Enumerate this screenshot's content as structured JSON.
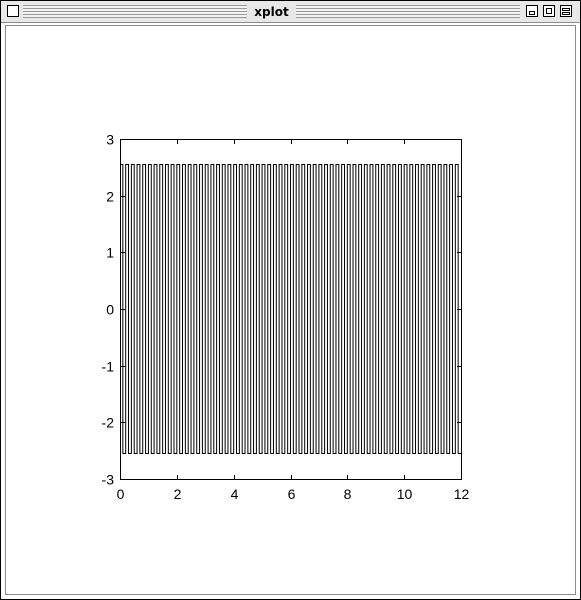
{
  "window": {
    "title": "xplot",
    "buttons": {
      "close": "close-icon",
      "minimize": "minimize-icon",
      "zoom": "zoom-icon",
      "shade": "shade-icon"
    }
  },
  "colors": {
    "trace": "#000000",
    "background": "#ffffff",
    "titlebar": "#e8e8e8"
  },
  "chart_data": {
    "type": "line",
    "title": "",
    "xlabel": "",
    "ylabel": "",
    "xlim": [
      0,
      12
    ],
    "ylim": [
      -3,
      3
    ],
    "x_ticks": [
      0,
      2,
      4,
      6,
      8,
      10,
      12
    ],
    "y_ticks": [
      -3,
      -2,
      -1,
      0,
      1,
      2,
      3
    ],
    "x_tick_labels": [
      "0",
      "2",
      "4",
      "6",
      "8",
      "10",
      "12"
    ],
    "y_tick_labels": [
      "-3",
      "-2",
      "-1",
      "0",
      "1",
      "2",
      "3"
    ],
    "grid": false,
    "legend": "none",
    "series": [
      {
        "waveform": "square",
        "period": 0.2,
        "high": 2.55,
        "low": -2.55,
        "x_range": [
          0,
          12
        ]
      }
    ]
  }
}
